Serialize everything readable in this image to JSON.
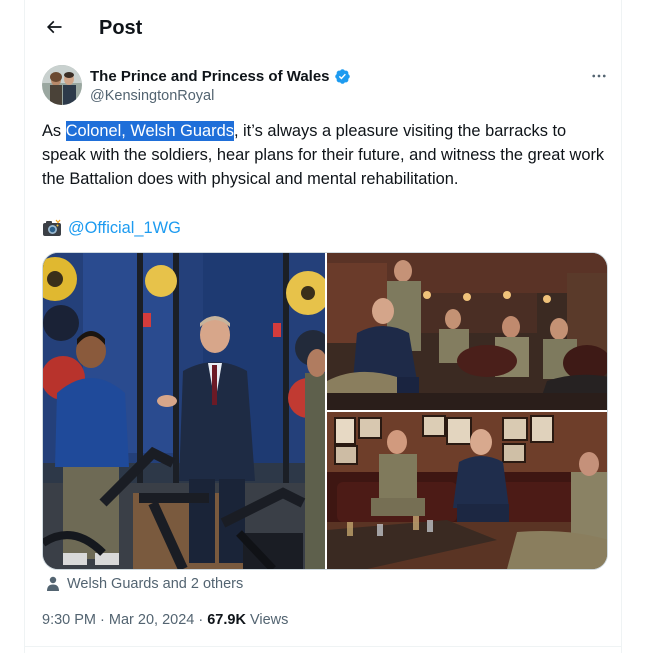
{
  "header": {
    "title": "Post",
    "back_icon": "arrow-left-icon"
  },
  "author": {
    "name": "The Prince and Princess of Wales",
    "handle": "@KensingtonRoyal",
    "verified_color": "#1d9bf0"
  },
  "tweet": {
    "text_prefix": "As ",
    "text_highlight": "Colonel, Welsh Guards",
    "text_suffix": ", it’s always a pleasure visiting the barracks to speak with the soldiers, hear plans for their future, and witness the great work the Battalion does with physical and mental rehabilitation.",
    "camera_icon": "camera-icon",
    "mention": "@Official_1WG"
  },
  "media": {
    "photos": [
      "photo-gym-visit",
      "photo-soldiers-seated-bar",
      "photo-prince-seated-leather-sofa"
    ]
  },
  "tags": {
    "text": "Welsh Guards and 2 others"
  },
  "meta": {
    "time": "9:30 PM",
    "separator": " · ",
    "date": "Mar 20, 2024",
    "separator2": " · ",
    "views_count": "67.9K",
    "views_label": " Views"
  },
  "colors": {
    "accent": "#1d9bf0",
    "text": "#0f1419",
    "muted": "#536471",
    "highlight": "#1f6fd9"
  }
}
